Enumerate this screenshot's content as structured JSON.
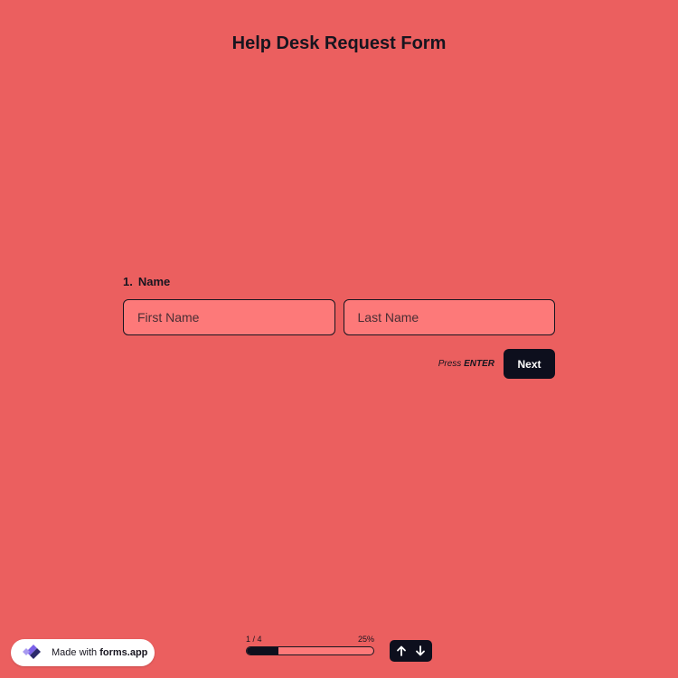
{
  "form": {
    "title": "Help Desk Request Form"
  },
  "question": {
    "number": "1.",
    "label": "Name",
    "first_name_placeholder": "First Name",
    "last_name_placeholder": "Last Name",
    "press_hint_prefix": "Press",
    "press_hint_key": "ENTER",
    "next_label": "Next"
  },
  "footer": {
    "badge_prefix": "Made with",
    "badge_brand": "forms.app",
    "progress_step": "1 / 4",
    "progress_percent": "25%",
    "progress_value": 0.25,
    "icons": {
      "logo": "forms-app-logo-icon",
      "up": "arrow-up-icon",
      "down": "arrow-down-icon"
    }
  },
  "colors": {
    "background": "#eb5f5f",
    "input_fill": "#fd7979",
    "dark": "#0d0f1d",
    "text": "#17151f"
  }
}
